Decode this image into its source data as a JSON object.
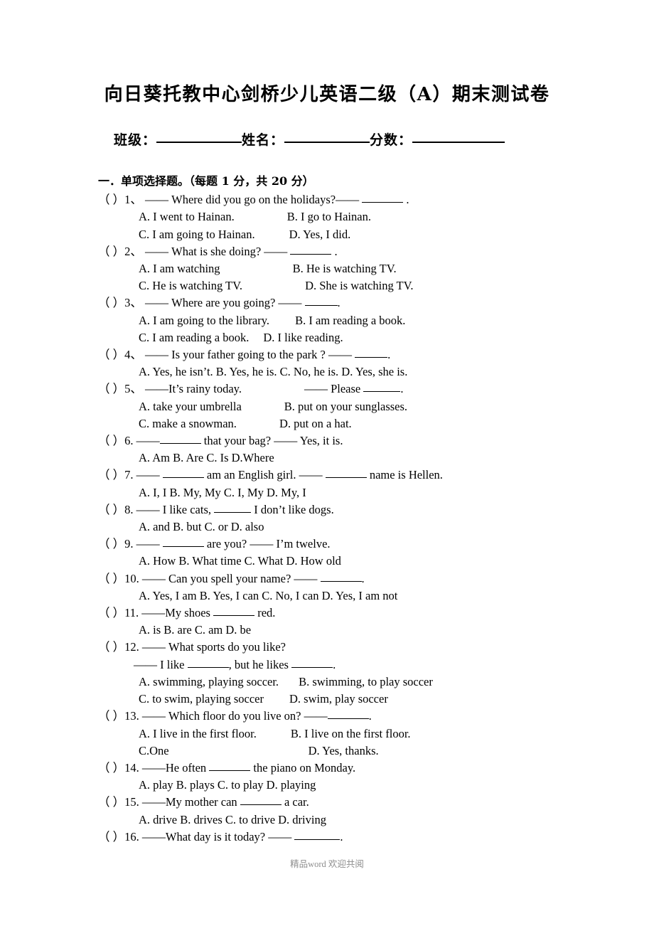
{
  "document": {
    "title": "向日葵托教中心剑桥少儿英语二级（A）期末测试卷",
    "info": {
      "class_label": "班级：",
      "name_label": "姓名：",
      "score_label": "分数："
    },
    "footer_watermark": "精品word 欢迎共阅"
  },
  "section": {
    "heading": "一．单项选择题。（每题 1 分，共 20 分）"
  },
  "questions": [
    {
      "marker": "（  ）1、",
      "stem": "—— Where did you go on the holidays?—— ______ .",
      "stem_pre": "—— Where did you go on the holidays?——",
      "stem_post": ".",
      "lines": [
        {
          "left": "A. I went to Hainan.",
          "right": "B. I go to Hainan."
        },
        {
          "left": "C. I am going to Hainan.",
          "right": "D. Yes, I did."
        }
      ]
    },
    {
      "marker": "（  ）2、",
      "stem_pre": "—— What is she doing? ——",
      "stem_post": ".",
      "lines": [
        {
          "left": "A. I am watching",
          "right": "B. He is watching TV."
        },
        {
          "left": "C. He is watching TV.",
          "right": "D. She is watching TV."
        }
      ]
    },
    {
      "marker": "（  ）3、",
      "stem_pre": "—— Where are you going? ——",
      "stem_post": ".",
      "lines": [
        {
          "left": "A. I am going to the library.",
          "right": "B. I am reading a book."
        },
        {
          "left": "C. I am reading a book.",
          "right": "D. I like reading."
        }
      ]
    },
    {
      "marker": "（  ）4、",
      "stem_pre": "—— Is your father going to the park ?  ——",
      "stem_post": ".",
      "options_single": "A. Yes, he isn’t.    B. Yes, he is.     C. No, he is.        D. Yes, she is."
    },
    {
      "marker": "（  ）5、",
      "stem_pre": "——It’s rainy today.",
      "stem_mid": "—— Please",
      "stem_post": ".",
      "lines": [
        {
          "left": "A. take your umbrella",
          "right": "B. put on your sunglasses."
        },
        {
          "left": "C. make a snowman.",
          "right": "D. put on a hat."
        }
      ]
    },
    {
      "marker": "（  ）6.",
      "stem_pre": "——",
      "stem_mid": "that your bag?    —— Yes, it is.",
      "options_single": "A. Am           B. Are         C. Is         D.Where"
    },
    {
      "marker": "（  ）7.",
      "stem_pre": "——",
      "stem_mid": "am an English girl.   ——",
      "stem_post": "name is Hellen.",
      "options_single": "A. I, I       B. My, My       C. I, My        D. My, I"
    },
    {
      "marker": "（  ）8.",
      "stem_pre": "—— I like cats,",
      "stem_post": "I don’t like dogs.",
      "options_single": "A. and        B. but          C. or         D. also"
    },
    {
      "marker": "（  ）9.",
      "stem_pre": "——",
      "stem_post": "are you?        —— I’m twelve.",
      "options_single": "A. How        B. What time     C. What        D. How old"
    },
    {
      "marker": "（  ）10.",
      "stem_pre": "—— Can you spell your name?  ——",
      "stem_post": ".",
      "options_single": "A. Yes, I am   B. Yes, I can   C. No, I can   D. Yes, I am not"
    },
    {
      "marker": "（  ）11.",
      "stem_pre": "——My shoes",
      "stem_post": "red.",
      "options_single": "A. is        B. are         C. am        D. be"
    },
    {
      "marker": "（  ）12.",
      "stem_pre": "—— What sports do you like?",
      "stem_second_pre": "—— I like",
      "stem_second_mid": ", but he likes",
      "stem_second_post": ".",
      "lines": [
        {
          "left": "A. swimming, playing soccer.",
          "right": "B. swimming, to play soccer"
        },
        {
          "left": "C. to swim, playing soccer",
          "right": "D. swim, play soccer"
        }
      ]
    },
    {
      "marker": "（  ）13.",
      "stem_pre": "—— Which floor do you live on?   ——",
      "stem_post": ".",
      "lines": [
        {
          "left": "A. I live in the first floor.",
          "right": "B. I live on the first floor."
        },
        {
          "left": "C.One",
          "right": "D. Yes, thanks."
        }
      ]
    },
    {
      "marker": "（  ）14.",
      "stem_pre": "——He often",
      "stem_post": "the piano on Monday.",
      "options_single": "A. play    B. plays     C. to play     D. playing"
    },
    {
      "marker": "（  ）15.",
      "stem_pre": "——My mother can",
      "stem_post": "a car.",
      "options_single": "A. drive    B. drives   C. to drive    D. driving"
    },
    {
      "marker": "（  ）16.",
      "stem_pre": "——What day is it today?     ——",
      "stem_post": "."
    }
  ]
}
